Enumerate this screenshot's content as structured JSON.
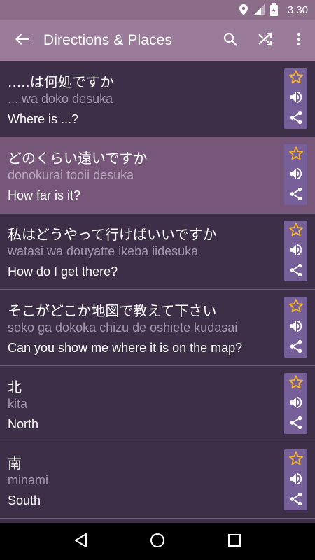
{
  "status_bar": {
    "time": "3:30"
  },
  "app_bar": {
    "title": "Directions & Places"
  },
  "phrases": [
    {
      "japanese": ".....は何処ですか",
      "romaji": "....wa doko desuka",
      "english": "Where is ...?",
      "highlighted": false
    },
    {
      "japanese": "どのくらい遠いですか",
      "romaji": "donokurai tooii desuka",
      "english": "How far is it?",
      "highlighted": true
    },
    {
      "japanese": "私はどうやって行けばいいですか",
      "romaji": "watasi wa douyatte ikeba iidesuka",
      "english": "How do I get there?",
      "highlighted": false
    },
    {
      "japanese": "そこがどこか地図で教えて下さい",
      "romaji": "soko ga dokoka chizu de oshiete kudasai",
      "english": "Can you show me where it is on the map?",
      "highlighted": false
    },
    {
      "japanese": "北",
      "romaji": "kita",
      "english": "North",
      "highlighted": false
    },
    {
      "japanese": "南",
      "romaji": "minami",
      "english": "South",
      "highlighted": false
    }
  ],
  "colors": {
    "status_bar": "#8b6d8a",
    "app_bar": "#9b7b9a",
    "list_background": "#3d2f48",
    "highlight_row": "#76577a",
    "action_panel": "#77609a",
    "star": "#f5b32b"
  },
  "icons": [
    "location-icon",
    "signal-icon",
    "battery-icon",
    "back-arrow-icon",
    "search-icon",
    "shuffle-icon",
    "more-vert-icon",
    "star-icon",
    "speaker-icon",
    "share-icon",
    "nav-back-icon",
    "nav-home-icon",
    "nav-recents-icon"
  ]
}
